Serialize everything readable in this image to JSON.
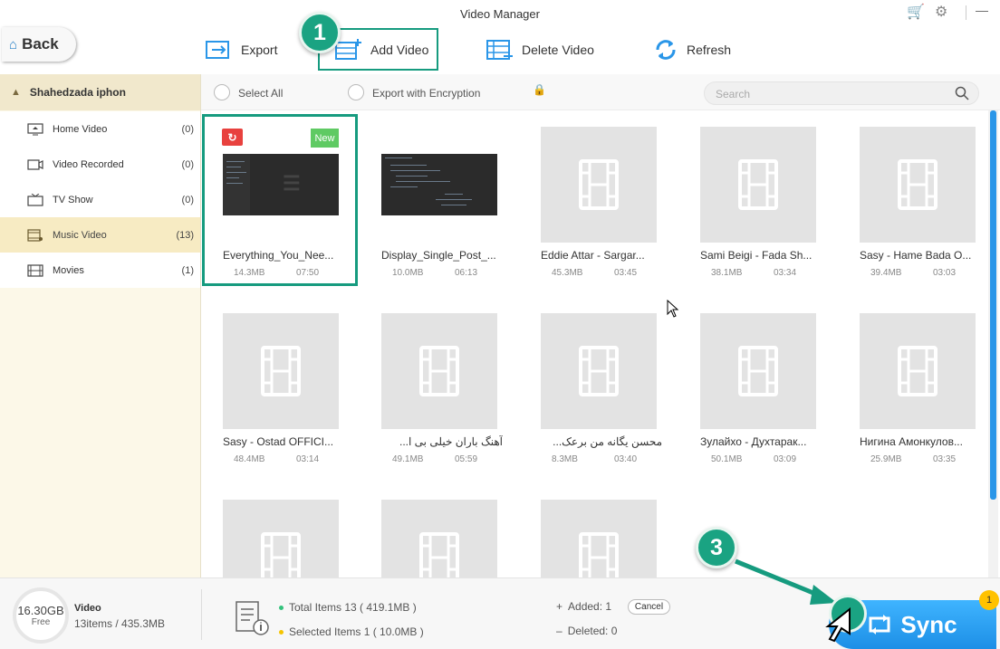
{
  "window": {
    "title": "Video Manager"
  },
  "toolbar": {
    "back_label": "Back",
    "export_label": "Export",
    "add_video_label": "Add Video",
    "delete_video_label": "Delete Video",
    "refresh_label": "Refresh"
  },
  "annotations": {
    "step1": "1",
    "step3": "3"
  },
  "sidebar": {
    "device_name": "Shahedzada iphon",
    "items": [
      {
        "label": "Home Video",
        "count": "(0)",
        "icon": "home-video-icon"
      },
      {
        "label": "Video Recorded",
        "count": "(0)",
        "icon": "camera-icon"
      },
      {
        "label": "TV Show",
        "count": "(0)",
        "icon": "tv-icon"
      },
      {
        "label": "Music Video",
        "count": "(13)",
        "icon": "music-video-icon"
      },
      {
        "label": "Movies",
        "count": "(1)",
        "icon": "film-icon"
      }
    ]
  },
  "subbar": {
    "select_all_label": "Select All",
    "export_encryption_label": "Export with Encryption",
    "search_placeholder": "Search"
  },
  "videos": [
    {
      "name": "Everything_You_Nee...",
      "size": "14.3MB",
      "duration": "07:50",
      "badge": "New"
    },
    {
      "name": "Display_Single_Post_...",
      "size": "10.0MB",
      "duration": "06:13"
    },
    {
      "name": "Eddie Attar - Sargar...",
      "size": "45.3MB",
      "duration": "03:45"
    },
    {
      "name": "Sami Beigi - Fada Sh...",
      "size": "38.1MB",
      "duration": "03:34"
    },
    {
      "name": "Sasy - Hame Bada O...",
      "size": "39.4MB",
      "duration": "03:03"
    },
    {
      "name": "Sasy - Ostad OFFICI...",
      "size": "48.4MB",
      "duration": "03:14"
    },
    {
      "name": "آهنگ باران خیلی بی ا...",
      "size": "49.1MB",
      "duration": "05:59"
    },
    {
      "name": "محسن یگانه من برعک...",
      "size": "8.3MB",
      "duration": "03:40"
    },
    {
      "name": "Зулайхо - Духтарак...",
      "size": "50.1MB",
      "duration": "03:09"
    },
    {
      "name": "Нигина Амонкулов...",
      "size": "25.9MB",
      "duration": "03:35"
    },
    {
      "name": "",
      "size": "",
      "duration": ""
    },
    {
      "name": "",
      "size": "",
      "duration": ""
    },
    {
      "name": "",
      "size": "",
      "duration": ""
    }
  ],
  "footer": {
    "storage_value": "16.30GB",
    "storage_label": "Free",
    "type_label": "Video",
    "items_summary": "13items / 435.3MB",
    "total_items": "Total Items  13  ( 419.1MB )",
    "selected_items": "Selected Items  1  ( 10.0MB )",
    "added": "Added:  1",
    "deleted": "Deleted:  0",
    "cancel_label": "Cancel",
    "sync_label": "Sync",
    "sync_badge": "1"
  },
  "colors": {
    "accent_blue": "#2a96e8",
    "annotation_green": "#169b7f",
    "sidebar_bg": "#fcf8e8",
    "active_item": "#f7ebc3",
    "new_badge": "#5fca63"
  }
}
